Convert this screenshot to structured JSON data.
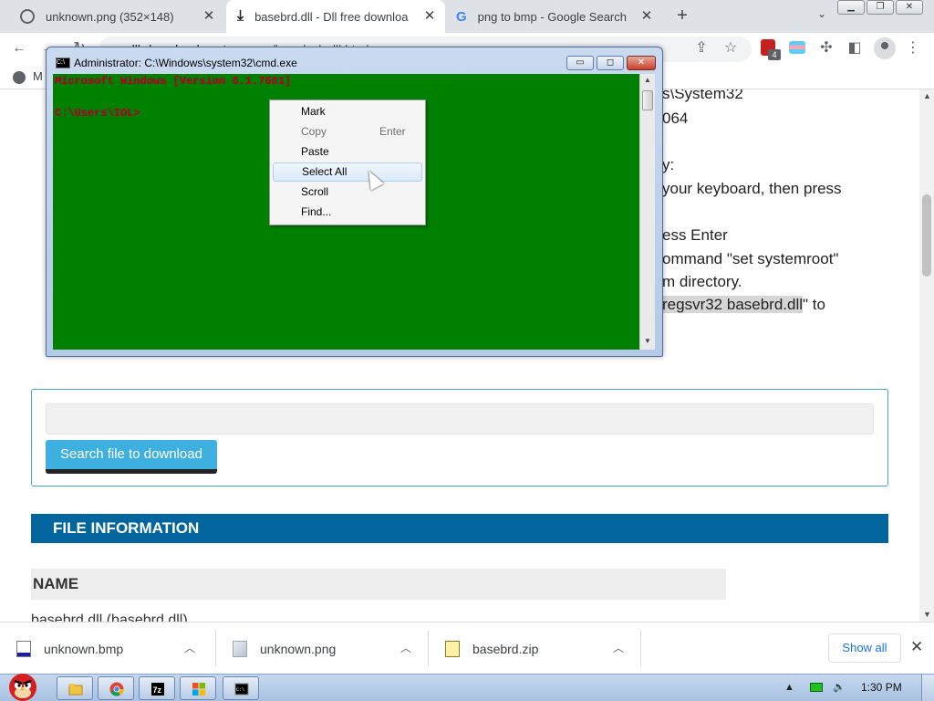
{
  "browser": {
    "tabs": [
      {
        "title": "unknown.png (352×148)",
        "icon": "globe-icon",
        "active": false
      },
      {
        "title": "basebrd.dll - Dll free downloa",
        "icon": "download-icon",
        "active": true
      },
      {
        "title": "png to bmp - Google Search",
        "icon": "google-icon",
        "active": false
      }
    ],
    "url_host": "dll-download-system.com",
    "url_path": "/basebrd_dll.html",
    "bookmark_partial": "M"
  },
  "page": {
    "step_lines": [
      "s\\System32",
      "064",
      "y:",
      "your keyboard, then press",
      "ess Enter",
      "ommand \"set systemroot\"",
      "m directory."
    ],
    "regsvr_highlight": "regsvr32 basebrd.dll",
    "regsvr_suffix": "\" to",
    "search_input_value": "",
    "search_button": "Search file to download",
    "file_info_header": "FILE INFORMATION",
    "name_label": "NAME",
    "name_value_partial": "basebrd.dll (basebrd.dll)"
  },
  "cmd": {
    "title": "Administrator: C:\\Windows\\system32\\cmd.exe",
    "line1": "Microsoft Windows [Version 6.1.7601]",
    "line2": "C:\\Users\\IOL>",
    "icon_text": "C:\\"
  },
  "context_menu": {
    "items": [
      {
        "label": "Mark",
        "shortcut": "",
        "disabled": false,
        "hover": false
      },
      {
        "label": "Copy",
        "shortcut": "Enter",
        "disabled": true,
        "hover": false
      },
      {
        "label": "Paste",
        "shortcut": "",
        "disabled": false,
        "hover": false
      },
      {
        "label": "Select All",
        "shortcut": "",
        "disabled": false,
        "hover": true
      },
      {
        "label": "Scroll",
        "shortcut": "",
        "disabled": false,
        "hover": false
      },
      {
        "label": "Find...",
        "shortcut": "",
        "disabled": false,
        "hover": false
      }
    ]
  },
  "downloads": {
    "items": [
      {
        "name": "unknown.bmp",
        "icon": "bmp-file-icon"
      },
      {
        "name": "unknown.png",
        "icon": "png-file-icon"
      },
      {
        "name": "basebrd.zip",
        "icon": "zip-file-icon"
      }
    ],
    "show_all": "Show all"
  },
  "taskbar": {
    "clock": "1:30 PM",
    "extension_badge": "4"
  },
  "colors": {
    "console_bg": "#008000",
    "console_text": "#c00000",
    "file_info_bg": "#03659d",
    "search_button_bg": "#3eb0e0"
  }
}
